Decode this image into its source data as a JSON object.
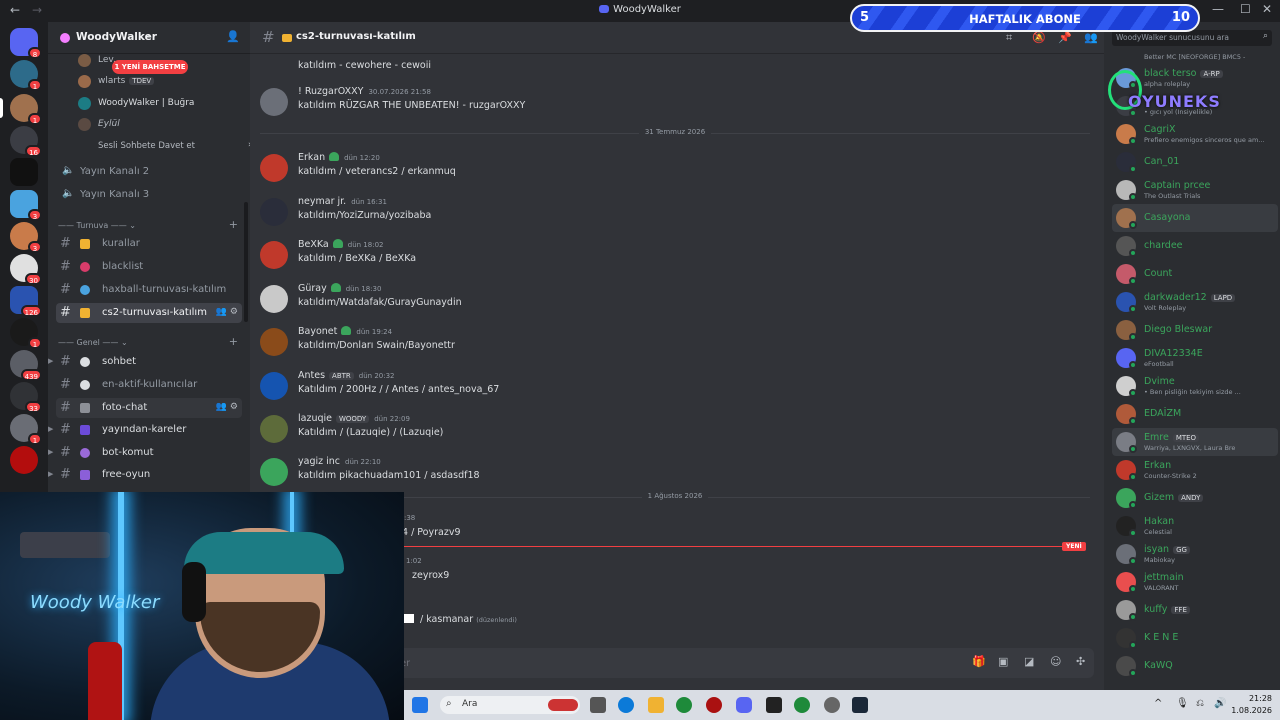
{
  "window": {
    "title": "WoodyWalker",
    "back": "←",
    "forward": "→",
    "minimize": "—",
    "maximize": "☐",
    "close": "✕"
  },
  "guild_badges": [
    "8",
    "1",
    "1",
    "16",
    "3",
    "3",
    "30",
    "126",
    "1",
    "439",
    "33",
    "1"
  ],
  "server": {
    "name": "WoodyWalker",
    "chevron": "⌄"
  },
  "voice": {
    "users": [
      "Lev...",
      "wlarts",
      "WoodyWalker | Buğra",
      "Eylül"
    ],
    "mention": "1 YENİ BAHSETME",
    "tdev_tag": "TDEV",
    "invite": "Sesli Sohbete Davet et",
    "channels": [
      "Yayın Kanalı 2",
      "Yayın Kanalı 3"
    ]
  },
  "categories": {
    "turnuva": "Turnuva",
    "genel": "Genel"
  },
  "channels": {
    "turnuva": [
      "kurallar",
      "blacklist",
      "haxball-turnuvası-katılım",
      "cs2-turnuvası-katılım"
    ],
    "genel": [
      "sohbet",
      "en-aktif-kullanıcılar",
      "foto-chat",
      "yayından-kareler",
      "bot-komut",
      "free-oyun"
    ]
  },
  "chat": {
    "title": "cs2-turnuvası-katılım",
    "top_partial_text": "katıldım - cewohere - cewoii",
    "messages": [
      {
        "user": "! RuzgarOXXY",
        "time": "30.07.2026 21:58",
        "text": "katıldım RÜZGAR THE UNBEATEN! - ruzgarOXXY",
        "color": "#3ba55c"
      },
      {
        "user": "Erkan",
        "time": "dün 12:20",
        "text": "katıldım / veterancs2 / erkanmuq",
        "color": "#3ba55c"
      },
      {
        "user": "neymar jr.",
        "time": "dün 16:31",
        "text": "katıldım/YoziZurna/yozibaba",
        "color": "#f2f3f5"
      },
      {
        "user": "BeXKa",
        "time": "dün 18:02",
        "text": "katıldım / BeXKa / BeXKa",
        "color": "#3ba55c"
      },
      {
        "user": "Güray",
        "time": "dün 18:30",
        "text": "katıldım/Watdafak/GurayGunaydin",
        "color": "#3ba55c"
      },
      {
        "user": "Bayonet",
        "time": "dün 19:24",
        "text": "katıldım/Donları Swain/Bayonettr",
        "color": "#3ba55c"
      },
      {
        "user": "Antes",
        "tag": "ABTR",
        "time": "dün 20:32",
        "text": "Katıldım / 200Hz / / Antes / antes_nova_67",
        "color": "#3ba55c"
      },
      {
        "user": "lazuqie",
        "tag": "WOODY",
        "time": "dün 22:09",
        "text": "Katıldım / (Lazuqie) / (Lazuqie)",
        "color": "#3ba55c"
      },
      {
        "user": "yagiz inc",
        "time": "dün 22:10",
        "text": "katıldım  pikachuadam101 / asdasdf18",
        "color": "#3ba55c"
      }
    ],
    "dividers": [
      "31 Temmuz 2026",
      "1 Ağustos 2026"
    ],
    "partial_messages": [
      {
        "ts": ":38",
        "text": "4 / Poyrazv9"
      },
      {
        "ts": "1:02",
        "text": "zeyrox9"
      },
      {
        "ts": "",
        "text": "/ kasmanar",
        "edited": "(düzenlendi)"
      }
    ],
    "new_label": "YENİ",
    "composer_placeholder": "atılım kanalına mesaj gönder"
  },
  "members": {
    "search_placeholder": "WoodyWalker sunucusunu ara",
    "top_partial": "Better MC [NEOFORGE] BMC5 -",
    "list": [
      {
        "name": "black terso",
        "tag": "A-RP",
        "activity": "alpha roleplay",
        "color": "#3ba55c"
      },
      {
        "name": "",
        "tag": "",
        "activity": "• gıcı yol (Insiyelikle)",
        "color": "#3ba55c"
      },
      {
        "name": "CagriX",
        "tag": "",
        "activity": "Prefiero enemigos sinceros que am...",
        "color": "#3ba55c"
      },
      {
        "name": "Can_01",
        "tag": "",
        "activity": "",
        "color": "#3ba55c"
      },
      {
        "name": "Captain prcee",
        "tag": "",
        "activity": "The Outlast Trials",
        "color": "#3ba55c"
      },
      {
        "name": "Casayona",
        "tag": "",
        "activity": "",
        "color": "#3ba55c"
      },
      {
        "name": "chardee",
        "tag": "",
        "activity": "",
        "color": "#3ba55c"
      },
      {
        "name": "Count",
        "tag": "",
        "activity": "",
        "color": "#3ba55c"
      },
      {
        "name": "darkwader12",
        "tag": "LAPD",
        "activity": "Volt Roleplay",
        "color": "#3ba55c"
      },
      {
        "name": "Diego Bleswar",
        "tag": "",
        "activity": "",
        "color": "#3ba55c"
      },
      {
        "name": "DIVA12334E",
        "tag": "",
        "activity": "eFootball",
        "color": "#3ba55c"
      },
      {
        "name": "Dvime",
        "tag": "",
        "activity": "• Ben pisliğin tekiyim sizde ...",
        "color": "#3ba55c"
      },
      {
        "name": "EDAİZM",
        "tag": "",
        "activity": "",
        "color": "#3ba55c"
      },
      {
        "name": "Emre",
        "tag": "MTEO",
        "activity": "Warriya, LXNGVX, Laura Bre",
        "color": "#3ba55c"
      },
      {
        "name": "Erkan",
        "tag": "",
        "activity": "Counter-Strike 2",
        "color": "#3ba55c"
      },
      {
        "name": "Gizem",
        "tag": "ANDY",
        "activity": "",
        "color": "#3ba55c"
      },
      {
        "name": "Hakan",
        "tag": "",
        "activity": "Celestial",
        "color": "#3ba55c"
      },
      {
        "name": "isyan",
        "tag": "GG",
        "activity": "Mabiokay",
        "color": "#3ba55c"
      },
      {
        "name": "jettmain",
        "tag": "",
        "activity": "VALORANT",
        "color": "#3ba55c"
      },
      {
        "name": "kuffy",
        "tag": "FFE",
        "activity": "",
        "color": "#3ba55c"
      },
      {
        "name": "K E N E",
        "tag": "",
        "activity": "",
        "color": "#3ba55c"
      },
      {
        "name": "KaWQ",
        "tag": "",
        "activity": "",
        "color": "#3ba55c"
      }
    ]
  },
  "overlay": {
    "left": "5",
    "center": "HAFTALIK ABONE",
    "right": "10",
    "logo": "OYUNEKS"
  },
  "webcam": {
    "neon": "Woody Walker"
  },
  "taskbar": {
    "search": "Ara",
    "time": "21:28",
    "date": "1.08.2026"
  }
}
